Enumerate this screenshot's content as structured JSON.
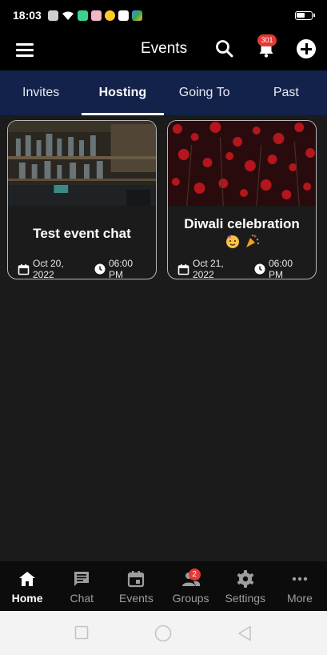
{
  "status_bar": {
    "time": "18:03"
  },
  "app_bar": {
    "title": "Events",
    "notification_count": "301"
  },
  "tabs": [
    {
      "label": "Invites",
      "active": false
    },
    {
      "label": "Hosting",
      "active": true
    },
    {
      "label": "Going To",
      "active": false
    },
    {
      "label": "Past",
      "active": false
    }
  ],
  "events": [
    {
      "title": "Test event chat",
      "date": "Oct 20, 2022",
      "time": "06:00 PM",
      "image": "bar-shelves-photo"
    },
    {
      "title": "Diwali celebration",
      "emoji": [
        "party-face-emoji",
        "party-popper-emoji"
      ],
      "date": "Oct 21, 2022",
      "time": "06:00 PM",
      "image": "red-flowers-photo"
    }
  ],
  "bottom_nav": [
    {
      "label": "Home",
      "icon": "home-icon",
      "active": true
    },
    {
      "label": "Chat",
      "icon": "chat-icon",
      "active": false
    },
    {
      "label": "Events",
      "icon": "calendar-icon",
      "active": false
    },
    {
      "label": "Groups",
      "icon": "groups-icon",
      "badge": "2",
      "active": false
    },
    {
      "label": "Settings",
      "icon": "gear-icon",
      "active": false
    },
    {
      "label": "More",
      "icon": "more-icon",
      "active": false
    }
  ],
  "colors": {
    "app_bar": "#000000",
    "tabs_bg": "#13224a",
    "body_bg": "#1b1b1b",
    "badge": "#e53935",
    "nav_bg": "#0c0c0c"
  }
}
